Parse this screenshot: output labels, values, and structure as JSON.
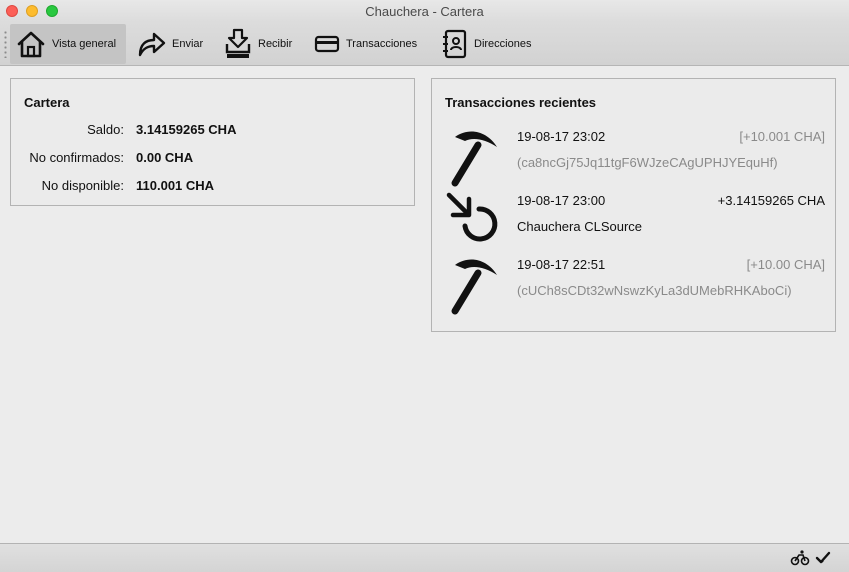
{
  "window": {
    "title": "Chauchera - Cartera"
  },
  "toolbar": {
    "items": [
      {
        "label": "Vista general",
        "icon": "home-icon",
        "active": true
      },
      {
        "label": "Enviar",
        "icon": "send-icon"
      },
      {
        "label": "Recibir",
        "icon": "receive-icon"
      },
      {
        "label": "Transacciones",
        "icon": "card-icon"
      },
      {
        "label": "Direcciones",
        "icon": "address-book-icon"
      }
    ]
  },
  "wallet": {
    "title": "Cartera",
    "balance_label": "Saldo:",
    "balance_value": "3.14159265 CHA",
    "unconfirmed_label": "No confirmados:",
    "unconfirmed_value": "0.00 CHA",
    "unavailable_label": "No disponible:",
    "unavailable_value": "110.001 CHA"
  },
  "recent": {
    "title": "Transacciones recientes",
    "transactions": [
      {
        "icon": "pickaxe-icon",
        "date": "19-08-17 23:02",
        "amount": "[+10.001 CHA]",
        "address": "(ca8ncGj75Jq11tgF6WJzeCAgUPHJYEquHf)",
        "status_color": "#8a8a8a"
      },
      {
        "icon": "receive-arrow-icon",
        "date": "19-08-17 23:00",
        "amount": "+3.14159265 CHA",
        "address": "Chauchera CLSource",
        "status_color": "#111111"
      },
      {
        "icon": "pickaxe-icon",
        "date": "19-08-17 22:51",
        "amount": "[+10.00 CHA]",
        "address": "(cUCh8sCDt32wNswzKyLa3dUMebRHKAboCi)",
        "status_color": "#8a8a8a"
      }
    ]
  },
  "statusbar": {
    "icons": [
      "network-sync-icon",
      "checkmark-icon"
    ]
  }
}
